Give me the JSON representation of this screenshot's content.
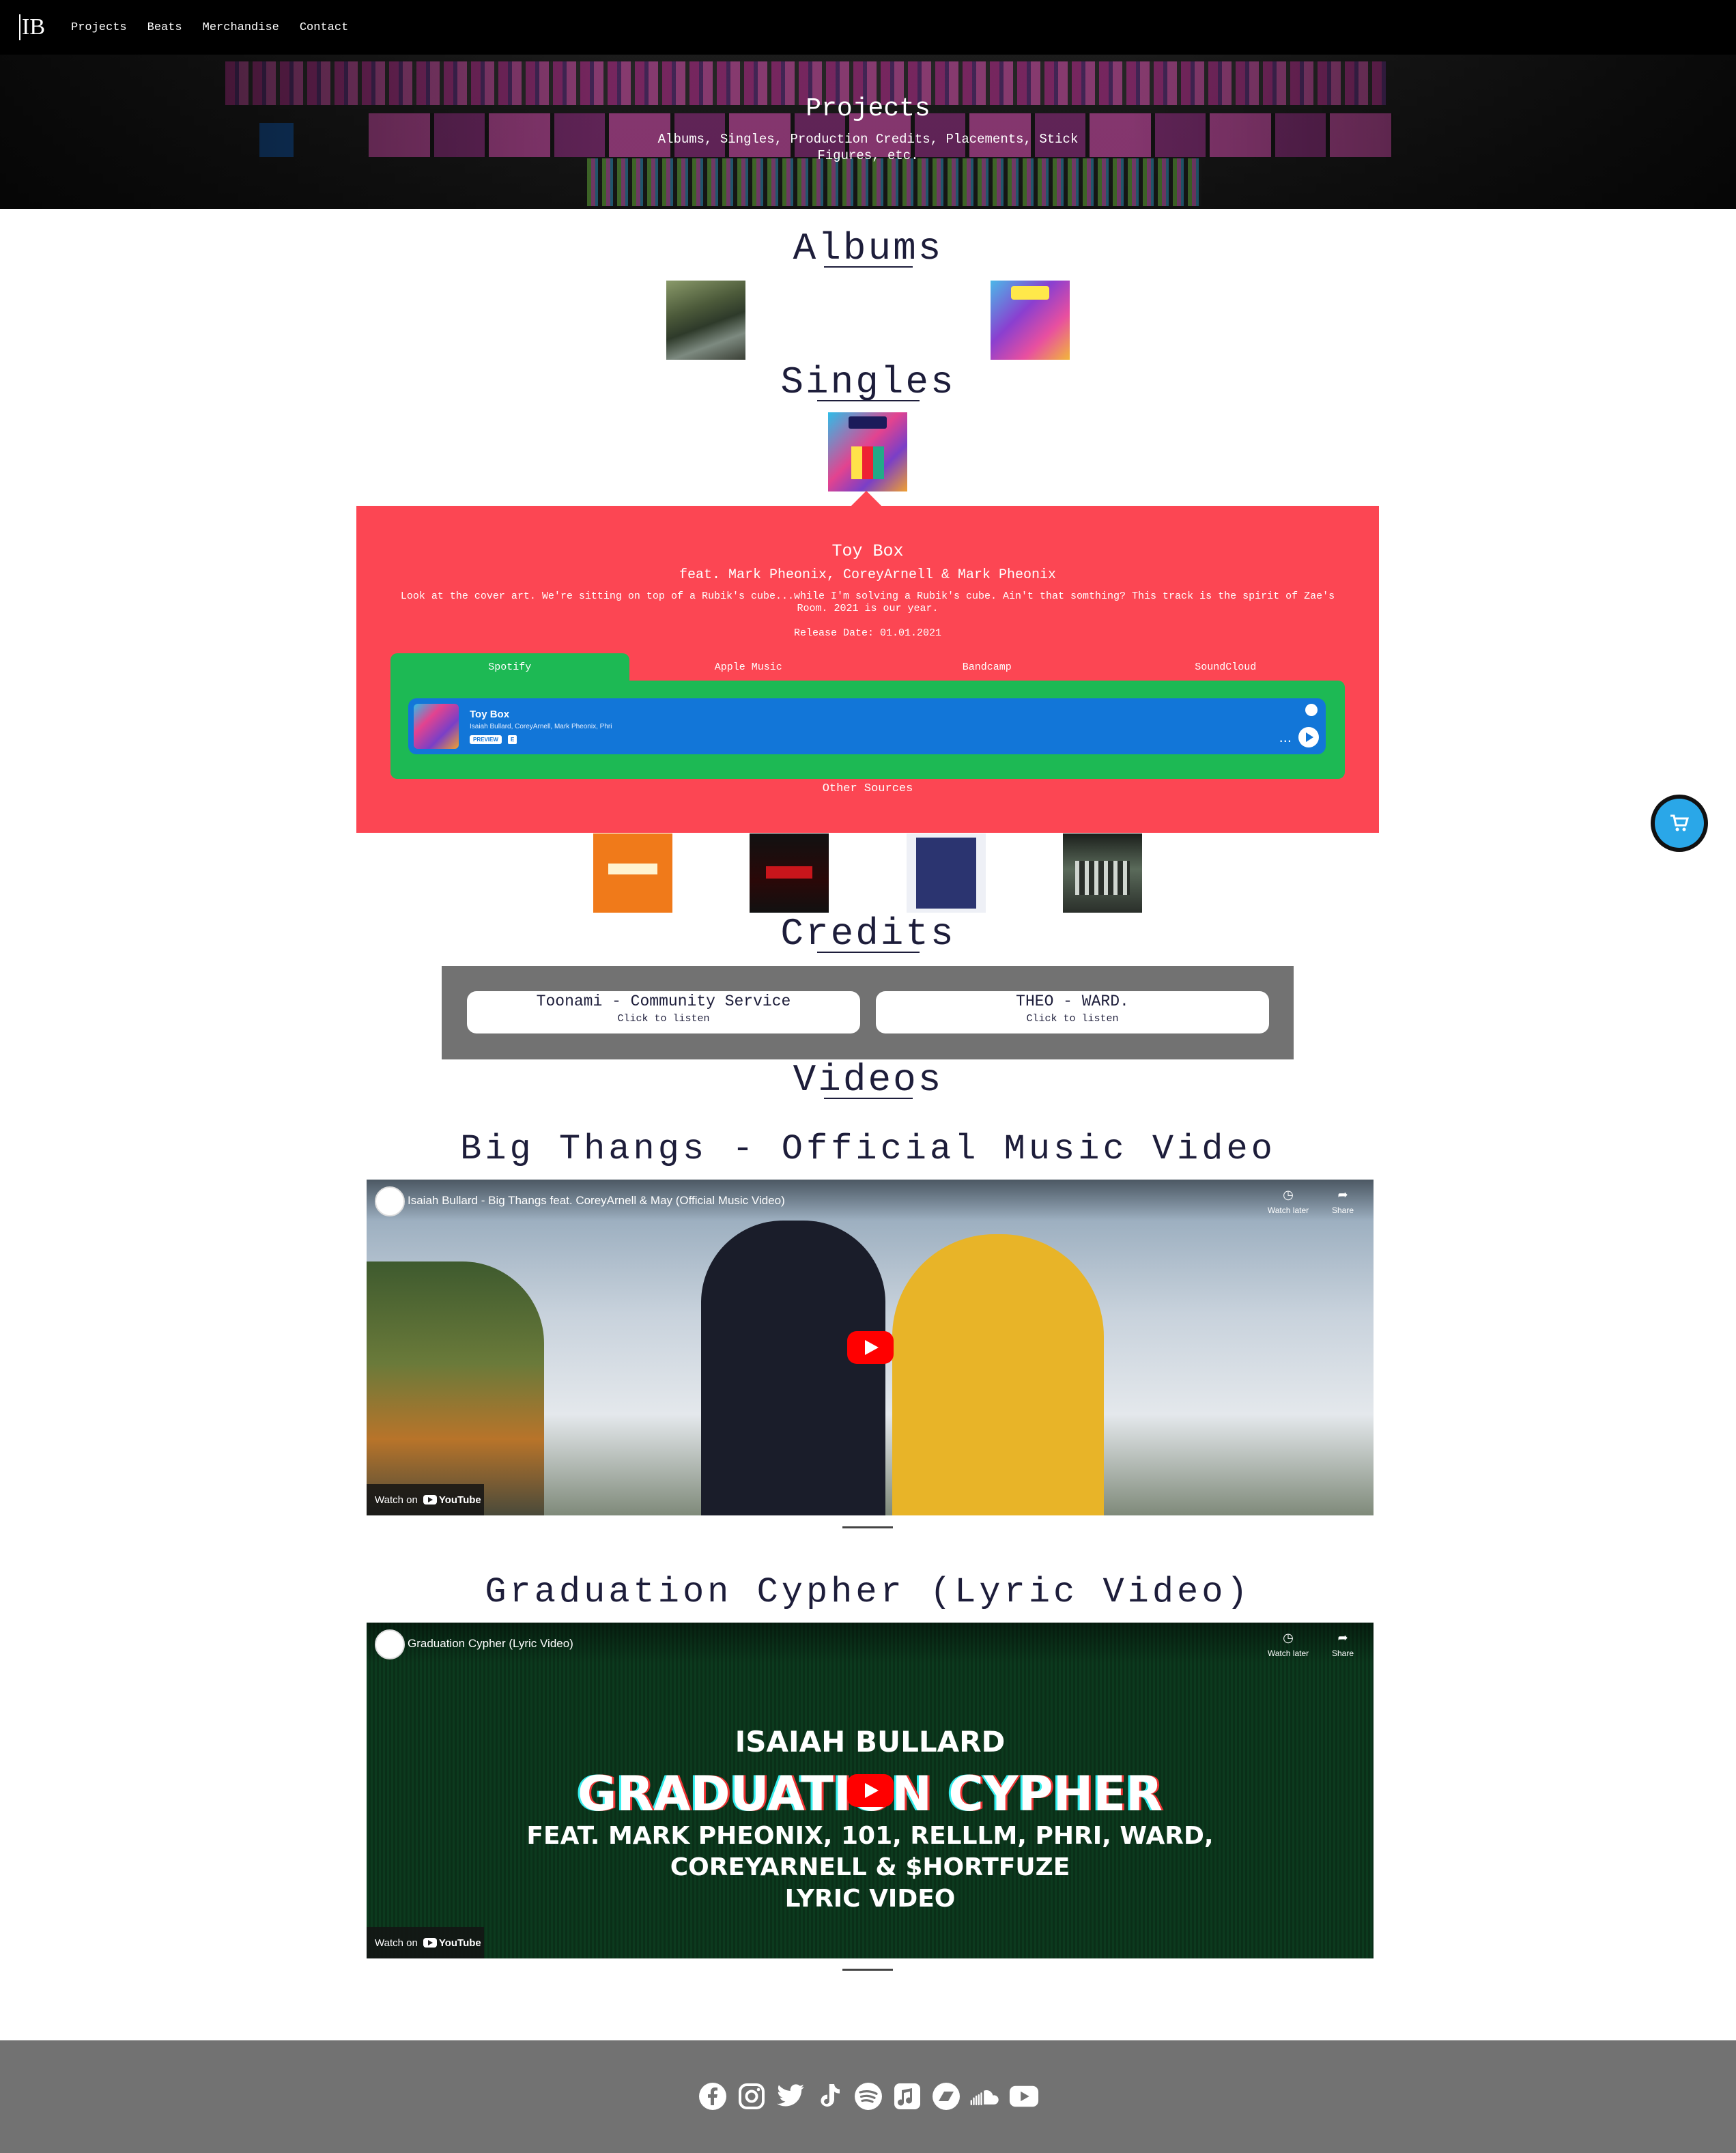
{
  "nav": {
    "logo": "IB",
    "links": [
      "Projects",
      "Beats",
      "Merchandise",
      "Contact"
    ]
  },
  "hero": {
    "title": "Projects",
    "subtitle": "Albums, Singles, Production Credits, Placements, Stick Figures, etc."
  },
  "sections": {
    "albums": "Albums",
    "singles": "Singles",
    "credits": "Credits",
    "videos": "Videos"
  },
  "single_panel": {
    "title": "Toy Box",
    "feat": "feat. Mark Pheonix, CoreyArnell & Mark Pheonix",
    "description": "Look at the cover art. We're sitting on top of a Rubik's cube...while I'm solving a Rubik's cube. Ain't that somthing? This track is the spirit of Zae's Room. 2021 is our year.",
    "release_date": "Release Date: 01.01.2021",
    "tabs": [
      "Spotify",
      "Apple Music",
      "Bandcamp",
      "SoundCloud"
    ],
    "active_tab": "Spotify",
    "player": {
      "track": "Toy Box",
      "artists": "Isaiah Bullard, CoreyArnell, Mark Pheonix, Phri",
      "badge": "PREVIEW",
      "explicit": "E",
      "more": "..."
    },
    "other_sources": "Other Sources"
  },
  "credits": [
    {
      "title": "Toonami - Community Service",
      "action": "Click to listen"
    },
    {
      "title": "THEO - WARD.",
      "action": "Click to listen"
    }
  ],
  "videos": [
    {
      "heading": "Big Thangs - Official Music Video",
      "embed_title": "Isaiah Bullard - Big Thangs feat. CoreyArnell & May (Official Music Video)",
      "watch_later": "Watch later",
      "share": "Share",
      "watch_on": "Watch on",
      "youtube": "YouTube"
    },
    {
      "heading": "Graduation Cypher (Lyric Video)",
      "embed_title": "Graduation Cypher (Lyric Video)",
      "watch_later": "Watch later",
      "share": "Share",
      "watch_on": "Watch on",
      "youtube": "YouTube",
      "thumb_lines": [
        "ISAIAH BULLARD",
        "GRADUATION CYPHER",
        "FEAT. MARK PHEONIX, 101, RELLLM, PHRI, WARD,",
        "COREYARNELL & $HORTFUZE",
        "LYRIC VIDEO"
      ]
    }
  ],
  "footer_icons": [
    "facebook-icon",
    "instagram-icon",
    "twitter-icon",
    "tiktok-icon",
    "spotify-icon",
    "apple-music-icon",
    "bandcamp-icon",
    "soundcloud-icon",
    "youtube-icon"
  ],
  "colors": {
    "panel": "#fc4653",
    "spotify_green": "#1db954",
    "player_blue": "#1276d8",
    "footer": "#727272",
    "cart": "#2aa7e8"
  }
}
